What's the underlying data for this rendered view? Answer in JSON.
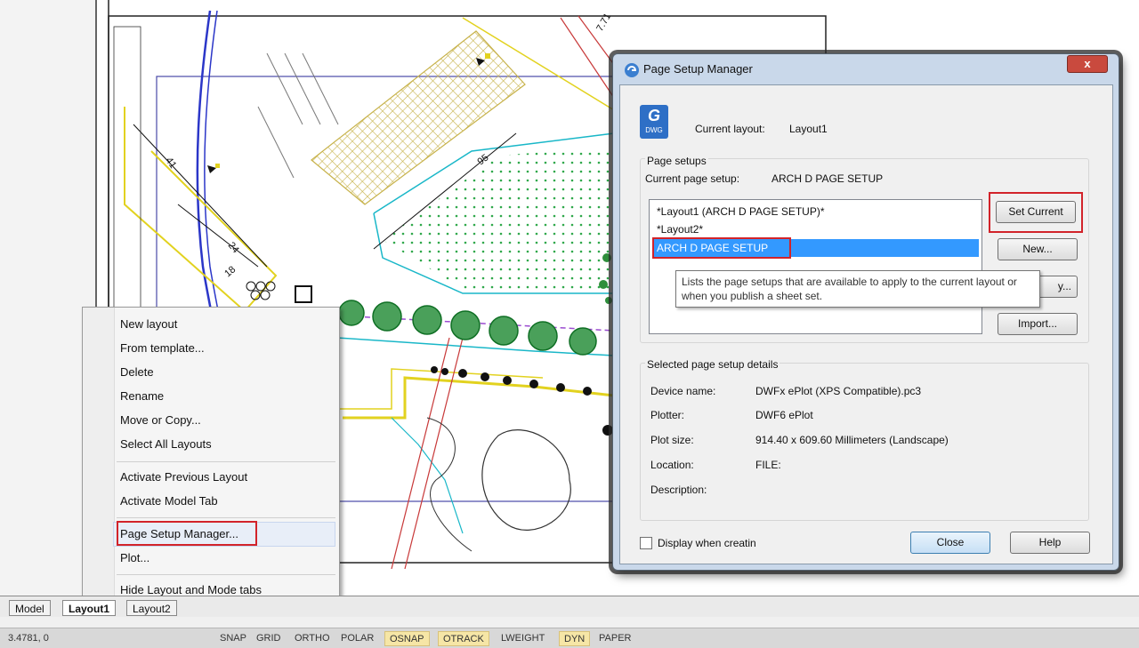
{
  "drawing": {
    "dimension_labels": [
      "95",
      "7.71",
      "24",
      "18",
      "41"
    ]
  },
  "context_menu": {
    "group1": [
      "New layout",
      "From template...",
      "Delete",
      "Rename",
      "Move or Copy...",
      "Select All Layouts"
    ],
    "group2": [
      "Activate Previous Layout",
      "Activate Model Tab"
    ],
    "group3": [
      "Page Setup Manager...",
      "Plot..."
    ],
    "group4": [
      "Hide Layout and Mode tabs"
    ]
  },
  "tabs": [
    "Model",
    "Layout1",
    "Layout2"
  ],
  "status_bar": {
    "coords": "3.4781, 0",
    "toggles": [
      {
        "label": "SNAP",
        "on": false
      },
      {
        "label": "GRID",
        "on": false
      },
      {
        "label": "ORTHO",
        "on": false
      },
      {
        "label": "POLAR",
        "on": false
      },
      {
        "label": "OSNAP",
        "on": true
      },
      {
        "label": "OTRACK",
        "on": true
      },
      {
        "label": "LWEIGHT",
        "on": false
      },
      {
        "label": "DYN",
        "on": true
      },
      {
        "label": "PAPER",
        "on": false
      }
    ]
  },
  "dialog": {
    "title": "Page Setup Manager",
    "close_glyph": "x",
    "icon": {
      "letter": "G",
      "caption": "DWG"
    },
    "current_layout_label": "Current layout:",
    "current_layout_value": "Layout1",
    "page_setups_label": "Page setups",
    "current_page_setup_label": "Current page setup:",
    "current_page_setup_value": "ARCH D PAGE SETUP",
    "setups": [
      "*Layout1 (ARCH D PAGE SETUP)*",
      "*Layout2*",
      "ARCH D PAGE SETUP"
    ],
    "buttons": {
      "set_current": "Set Current",
      "new": "New...",
      "modify": "y...",
      "import": "Import...",
      "close": "Close",
      "help": "Help"
    },
    "tooltip": "Lists the page setups that are available to apply to the current layout or when you publish a sheet set.",
    "details_label": "Selected page setup details",
    "details": [
      {
        "label": "Device name:",
        "value": "DWFx ePlot (XPS Compatible).pc3"
      },
      {
        "label": "Plotter:",
        "value": "DWF6 ePlot"
      },
      {
        "label": "Plot size:",
        "value": "914.40 x 609.60 Millimeters (Landscape)"
      },
      {
        "label": "Location:",
        "value": "FILE:"
      },
      {
        "label": "Description:",
        "value": ""
      }
    ],
    "display_when_creating": "Display when creatin"
  }
}
